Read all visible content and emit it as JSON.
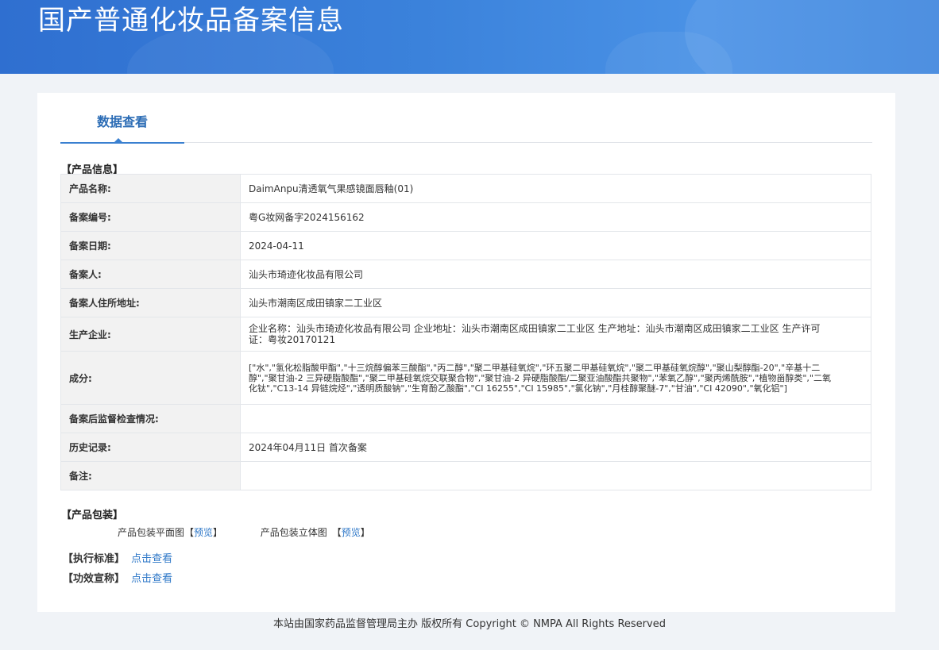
{
  "header": {
    "title": "国产普通化妆品备案信息"
  },
  "tabs": [
    {
      "label": "数据查看"
    }
  ],
  "product_info": {
    "section_title": "【产品信息】",
    "rows": [
      {
        "key": "产品名称:",
        "value": "DaimAnpu清透氧气果感镜面唇釉(01)"
      },
      {
        "key": "备案编号:",
        "value": "粤G妆网备字2024156162"
      },
      {
        "key": "备案日期:",
        "value": "2024-04-11"
      },
      {
        "key": "备案人:",
        "value": "汕头市琦迹化妆品有限公司"
      },
      {
        "key": "备案人住所地址:",
        "value": "汕头市潮南区成田镇家二工业区"
      },
      {
        "key": "生产企业:",
        "value": "企业名称：汕头市琦迹化妆品有限公司 企业地址：汕头市潮南区成田镇家二工业区 生产地址：汕头市潮南区成田镇家二工业区 生产许可证：粤妆20170121"
      },
      {
        "key": "成分:",
        "value": "[\"水\",\"氢化松脂酸甲酯\",\"十三烷醇偏苯三酸酯\",\"丙二醇\",\"聚二甲基硅氧烷\",\"环五聚二甲基硅氧烷\",\"聚二甲基硅氧烷醇\",\"聚山梨醇酯-20\",\"辛基十二醇\",\"聚甘油-2 三异硬脂酸酯\",\"聚二甲基硅氧烷交联聚合物\",\"聚甘油-2 异硬脂酸酯/二聚亚油酸酯共聚物\",\"苯氧乙醇\",\"聚丙烯酰胺\",\"植物甾醇类\",\"二氧化钛\",\"C13-14 异链烷烃\",\"透明质酸钠\",\"生育酚乙酸酯\",\"CI 16255\",\"CI 15985\",\"氯化钠\",\"月桂醇聚醚-7\",\"甘油\",\"CI 42090\",\"氧化铝\"]"
      },
      {
        "key": "备案后监督检查情况:",
        "value": ""
      },
      {
        "key": "历史记录:",
        "value": "2024年04月11日 首次备案"
      },
      {
        "key": "备注:",
        "value": ""
      }
    ]
  },
  "packaging": {
    "section_title": "【产品包装】",
    "flat_label": "产品包装平面图",
    "stereo_label": "产品包装立体图",
    "bracket_open": "【",
    "bracket_close": "】",
    "preview_link": "预览"
  },
  "standard": {
    "label": "【执行标准】",
    "link": "点击查看"
  },
  "efficacy": {
    "label": "【功效宣称】",
    "link": "点击查看"
  },
  "footer": {
    "text": "本站由国家药品监督管理局主办 版权所有 Copyright © NMPA All Rights Reserved"
  }
}
